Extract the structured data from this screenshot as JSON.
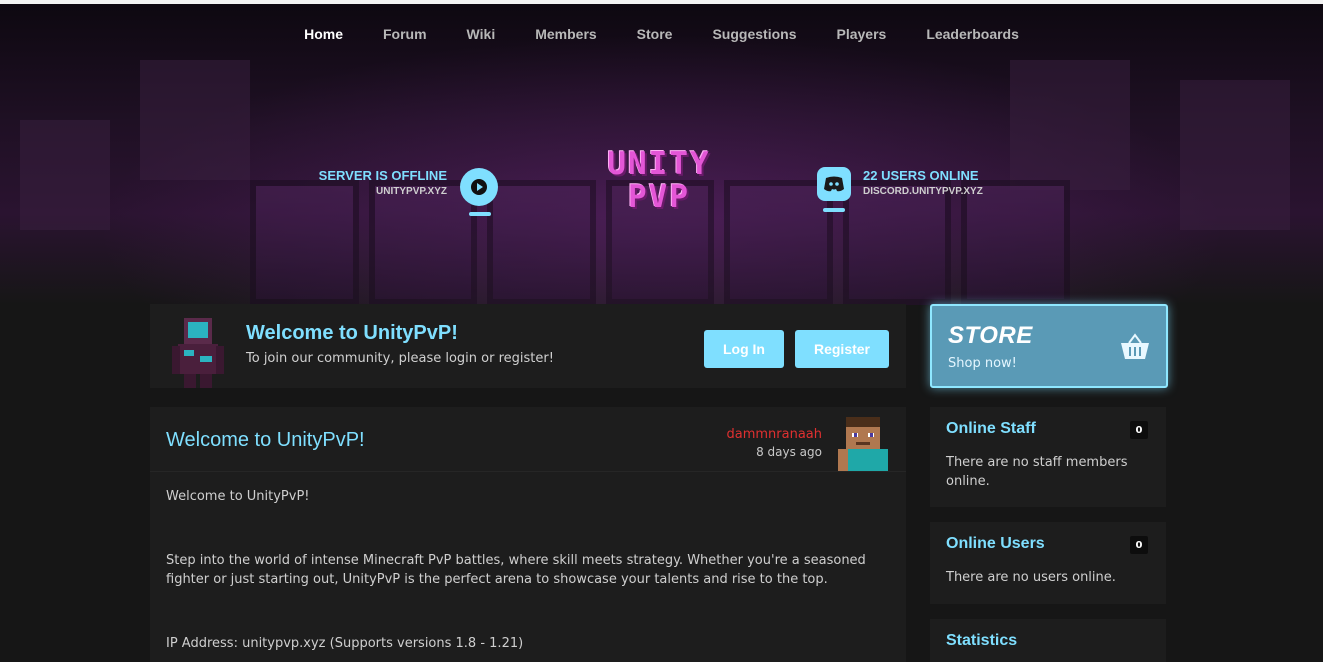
{
  "nav": {
    "items": [
      "Home",
      "Forum",
      "Wiki",
      "Members",
      "Store",
      "Suggestions",
      "Players",
      "Leaderboards"
    ],
    "active": "Home"
  },
  "server": {
    "status": "SERVER IS OFFLINE",
    "address": "UNITYPVP.XYZ"
  },
  "discord": {
    "users": "22 USERS ONLINE",
    "address": "DISCORD.UNITYPVP.XYZ"
  },
  "logo": {
    "line1": "UNITY",
    "line2": "PVP"
  },
  "welcome": {
    "title": "Welcome to UnityPvP!",
    "subtitle": "To join our community, please login or register!",
    "login_label": "Log In",
    "register_label": "Register"
  },
  "store": {
    "title": "STORE",
    "subtitle": "Shop now!"
  },
  "online_staff": {
    "title": "Online Staff",
    "count": "0",
    "text": "There are no staff members online."
  },
  "online_users": {
    "title": "Online Users",
    "count": "0",
    "text": "There are no users online."
  },
  "statistics": {
    "title": "Statistics"
  },
  "post": {
    "title": "Welcome to UnityPvP!",
    "author": "dammnranaah",
    "time": "8 days ago",
    "paragraphs": [
      "Welcome to UnityPvP!",
      "Step into the world of intense Minecraft PvP battles, where skill meets strategy. Whether you're a seasoned fighter or just starting out, UnityPvP is the perfect arena to showcase your talents and rise to the top.",
      "IP Address: unitypvp.xyz (Supports versions 1.8 - 1.21)"
    ]
  },
  "colors": {
    "accent": "#7fdfff",
    "logo": "#e356d6",
    "author": "#e03030",
    "panel": "#1d1d1d",
    "background": "#161616"
  },
  "icons": {
    "play": "play-icon",
    "discord": "discord-icon",
    "basket": "basket-icon"
  }
}
